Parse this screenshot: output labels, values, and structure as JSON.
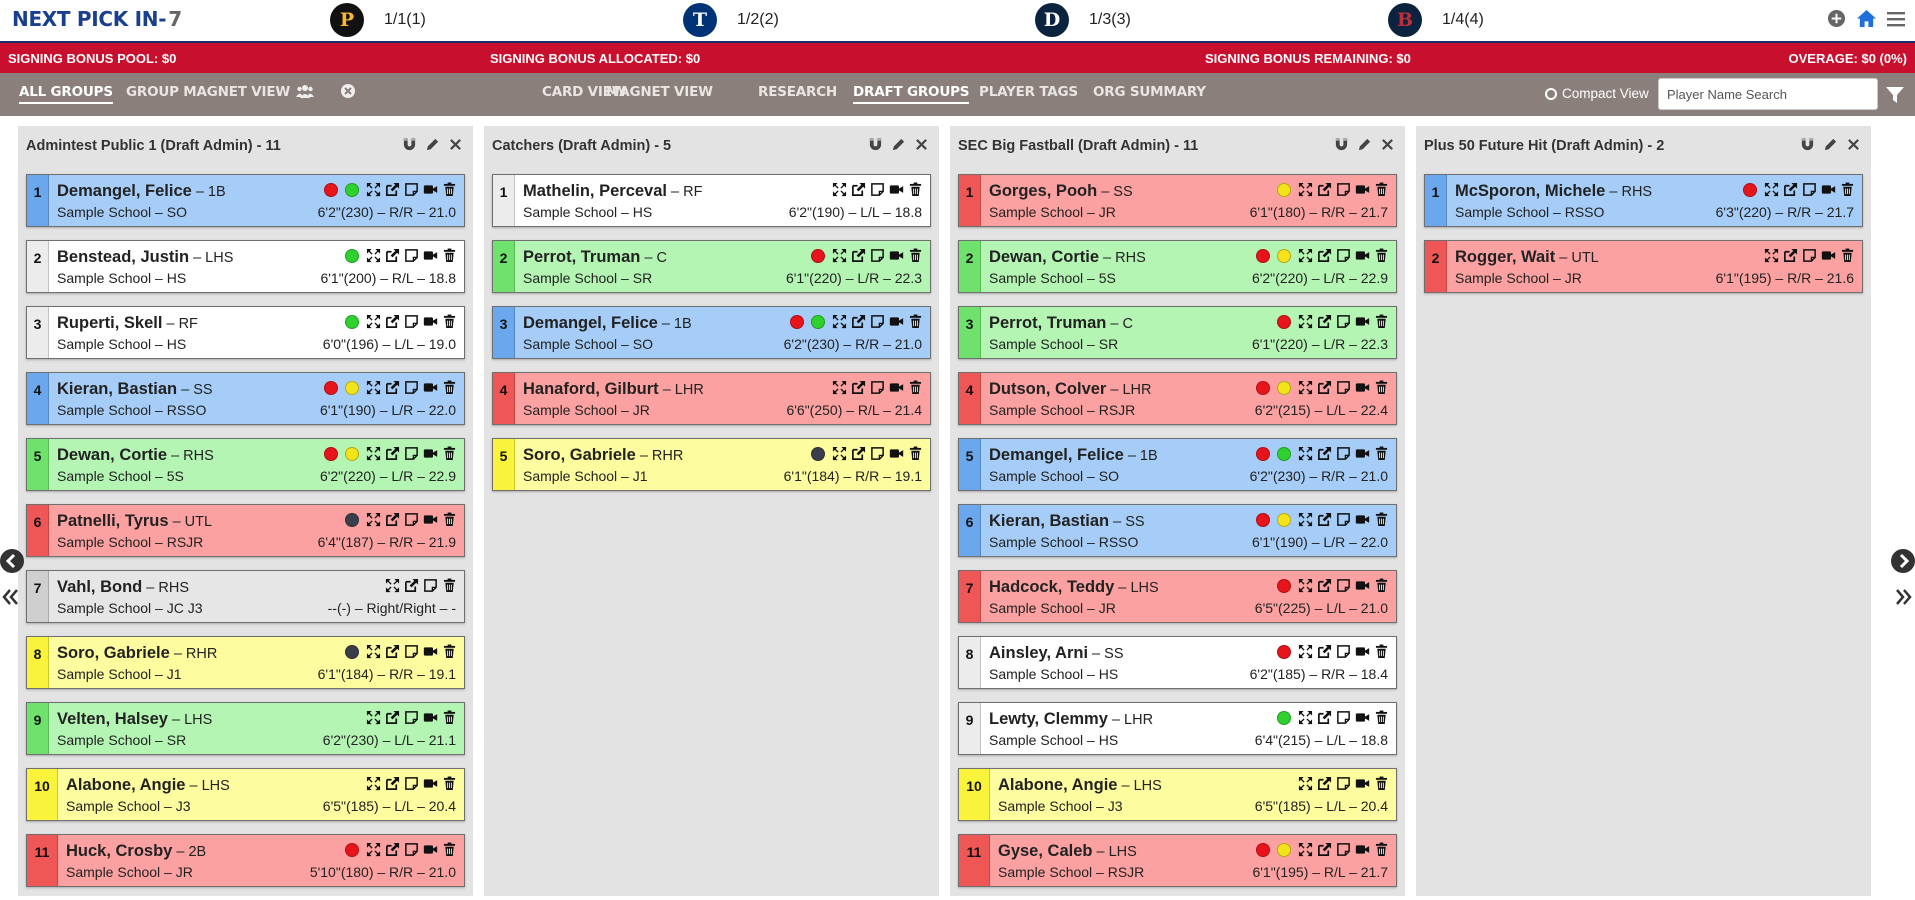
{
  "header": {
    "title": "NEXT PICK IN-",
    "count": "7",
    "picks": [
      {
        "label": "1/1(1)",
        "logo_letter": "P",
        "logo_bg": "#111111",
        "logo_fg": "#fdb827",
        "team": "pirates-logo-icon"
      },
      {
        "label": "1/2(2)",
        "logo_letter": "T",
        "logo_bg": "#003278",
        "logo_fg": "#ffffff",
        "team": "rangers-logo-icon"
      },
      {
        "label": "1/3(3)",
        "logo_letter": "D",
        "logo_bg": "#0c2340",
        "logo_fg": "#ffffff",
        "team": "tigers-logo-icon"
      },
      {
        "label": "1/4(4)",
        "logo_letter": "B",
        "logo_bg": "#0c2340",
        "logo_fg": "#bd3039",
        "team": "red-sox-logo-icon"
      }
    ]
  },
  "bonus": {
    "pool": "SIGNING BONUS POOL: $0",
    "allocated": "SIGNING BONUS ALLOCATED: $0",
    "remaining": "SIGNING BONUS REMAINING: $0",
    "overage": "OVERAGE: $0 (0%)"
  },
  "nav": {
    "all_groups": "ALL GROUPS",
    "group_magnet_view": "GROUP MAGNET VIEW",
    "card_view": "CARD VIEW",
    "magnet_view": "MAGNET VIEW",
    "research": "RESEARCH",
    "draft_groups": "DRAFT GROUPS",
    "player_tags": "PLAYER TAGS",
    "org_summary": "ORG SUMMARY",
    "compact_view": "Compact View",
    "search_placeholder": "Player Name Search"
  },
  "colors": {
    "brand_blue": "#1a3f8f",
    "bonus_red": "#c8102e",
    "nav_gray": "#8a7f7b",
    "dot_red": "#e8141c",
    "dot_green": "#2ed12e",
    "dot_yellow": "#f2e31b",
    "dot_dark": "#3a3e4a"
  },
  "groups": [
    {
      "title": "Admintest Public 1 (Draft Admin) - 11",
      "players": [
        {
          "num": "1",
          "name": "Demangel, Felice",
          "pos": " – 1B",
          "school": "Sample School – SO",
          "stats": "6'2\"(230) – R/R – 21.0",
          "color": "blue",
          "dots": [
            "red",
            "green"
          ],
          "video": true
        },
        {
          "num": "2",
          "name": "Benstead, Justin",
          "pos": " – LHS",
          "school": "Sample School – HS",
          "stats": "6'1\"(200) – R/L – 18.8",
          "color": "white",
          "dots": [
            "green"
          ],
          "video": true
        },
        {
          "num": "3",
          "name": "Ruperti, Skell",
          "pos": " – RF",
          "school": "Sample School – HS",
          "stats": "6'0\"(196) – L/L – 19.0",
          "color": "white",
          "dots": [
            "green"
          ],
          "video": true
        },
        {
          "num": "4",
          "name": "Kieran, Bastian",
          "pos": " – SS",
          "school": "Sample School – RSSO",
          "stats": "6'1\"(190) – L/R – 22.0",
          "color": "blue",
          "dots": [
            "red",
            "yellow"
          ],
          "video": true
        },
        {
          "num": "5",
          "name": "Dewan, Cortie",
          "pos": " – RHS",
          "school": "Sample School – 5S",
          "stats": "6'2\"(220) – L/R – 22.9",
          "color": "green",
          "dots": [
            "red",
            "yellow"
          ],
          "video": true
        },
        {
          "num": "6",
          "name": "Patnelli, Tyrus",
          "pos": " – UTL",
          "school": "Sample School – RSJR",
          "stats": "6'4\"(187) – R/R – 21.9",
          "color": "red",
          "dots": [
            "dark"
          ],
          "video": true
        },
        {
          "num": "7",
          "name": "Vahl, Bond",
          "pos": " – RHS",
          "school": "Sample School – JC J3",
          "stats": "--(-) – Right/Right – -",
          "color": "gray",
          "dots": [],
          "video": false
        },
        {
          "num": "8",
          "name": "Soro, Gabriele",
          "pos": " – RHR",
          "school": "Sample School – J1",
          "stats": "6'1\"(184) – R/R – 19.1",
          "color": "yellow",
          "dots": [
            "dark"
          ],
          "video": true
        },
        {
          "num": "9",
          "name": "Velten, Halsey",
          "pos": " – LHS",
          "school": "Sample School – SR",
          "stats": "6'2\"(230) – L/L – 21.1",
          "color": "green",
          "dots": [],
          "video": true
        },
        {
          "num": "10",
          "name": "Alabone, Angie",
          "pos": " – LHS",
          "school": "Sample School – J3",
          "stats": "6'5\"(185) – L/L – 20.4",
          "color": "yellow",
          "dots": [],
          "video": true
        },
        {
          "num": "11",
          "name": "Huck, Crosby",
          "pos": " – 2B",
          "school": "Sample School – JR",
          "stats": "5'10\"(180) – R/R – 21.0",
          "color": "red",
          "dots": [
            "red"
          ],
          "video": true
        }
      ]
    },
    {
      "title": "Catchers (Draft Admin) - 5",
      "players": [
        {
          "num": "1",
          "name": "Mathelin, Perceval",
          "pos": " – RF",
          "school": "Sample School – HS",
          "stats": "6'2\"(190) – L/L – 18.8",
          "color": "white",
          "dots": [],
          "video": true
        },
        {
          "num": "2",
          "name": "Perrot, Truman",
          "pos": " – C",
          "school": "Sample School – SR",
          "stats": "6'1\"(220) – L/R – 22.3",
          "color": "green",
          "dots": [
            "red"
          ],
          "video": true
        },
        {
          "num": "3",
          "name": "Demangel, Felice",
          "pos": " – 1B",
          "school": "Sample School – SO",
          "stats": "6'2\"(230) – R/R – 21.0",
          "color": "blue",
          "dots": [
            "red",
            "green"
          ],
          "video": true
        },
        {
          "num": "4",
          "name": "Hanaford, Gilburt",
          "pos": " – LHR",
          "school": "Sample School – JR",
          "stats": "6'6\"(250) – R/L – 21.4",
          "color": "red",
          "dots": [],
          "video": true
        },
        {
          "num": "5",
          "name": "Soro, Gabriele",
          "pos": " – RHR",
          "school": "Sample School – J1",
          "stats": "6'1\"(184) – R/R – 19.1",
          "color": "yellow",
          "dots": [
            "dark"
          ],
          "video": true
        }
      ]
    },
    {
      "title": "SEC Big Fastball (Draft Admin) - 11",
      "players": [
        {
          "num": "1",
          "name": "Gorges, Pooh",
          "pos": " – SS",
          "school": "Sample School – JR",
          "stats": "6'1\"(180) – R/R – 21.7",
          "color": "red",
          "dots": [
            "yellow"
          ],
          "video": true
        },
        {
          "num": "2",
          "name": "Dewan, Cortie",
          "pos": " – RHS",
          "school": "Sample School – 5S",
          "stats": "6'2\"(220) – L/R – 22.9",
          "color": "green",
          "dots": [
            "red",
            "yellow"
          ],
          "video": true
        },
        {
          "num": "3",
          "name": "Perrot, Truman",
          "pos": " – C",
          "school": "Sample School – SR",
          "stats": "6'1\"(220) – L/R – 22.3",
          "color": "green",
          "dots": [
            "red"
          ],
          "video": true
        },
        {
          "num": "4",
          "name": "Dutson, Colver",
          "pos": " – LHR",
          "school": "Sample School – RSJR",
          "stats": "6'2\"(215) – L/L – 22.4",
          "color": "red",
          "dots": [
            "red",
            "yellow"
          ],
          "video": true
        },
        {
          "num": "5",
          "name": "Demangel, Felice",
          "pos": " – 1B",
          "school": "Sample School – SO",
          "stats": "6'2\"(230) – R/R – 21.0",
          "color": "blue",
          "dots": [
            "red",
            "green"
          ],
          "video": true
        },
        {
          "num": "6",
          "name": "Kieran, Bastian",
          "pos": " – SS",
          "school": "Sample School – RSSO",
          "stats": "6'1\"(190) – L/R – 22.0",
          "color": "blue",
          "dots": [
            "red",
            "yellow"
          ],
          "video": true
        },
        {
          "num": "7",
          "name": "Hadcock, Teddy",
          "pos": " – LHS",
          "school": "Sample School – JR",
          "stats": "6'5\"(225) – L/L – 21.0",
          "color": "red",
          "dots": [
            "red"
          ],
          "video": true
        },
        {
          "num": "8",
          "name": "Ainsley, Arni",
          "pos": " – SS",
          "school": "Sample School – HS",
          "stats": "6'2\"(185) – R/R – 18.4",
          "color": "white",
          "dots": [
            "red"
          ],
          "video": true
        },
        {
          "num": "9",
          "name": "Lewty, Clemmy",
          "pos": " – LHR",
          "school": "Sample School – HS",
          "stats": "6'4\"(215) – L/L – 18.8",
          "color": "white",
          "dots": [
            "green"
          ],
          "video": true
        },
        {
          "num": "10",
          "name": "Alabone, Angie",
          "pos": " – LHS",
          "school": "Sample School – J3",
          "stats": "6'5\"(185) – L/L – 20.4",
          "color": "yellow",
          "dots": [],
          "video": true
        },
        {
          "num": "11",
          "name": "Gyse, Caleb",
          "pos": " – LHS",
          "school": "Sample School – RSJR",
          "stats": "6'1\"(195) – R/L – 21.7",
          "color": "red",
          "dots": [
            "red",
            "yellow"
          ],
          "video": true
        }
      ]
    },
    {
      "title": "Plus 50 Future Hit (Draft Admin) - 2",
      "players": [
        {
          "num": "1",
          "name": "McSporon, Michele",
          "pos": " – RHS",
          "school": "Sample School – RSSO",
          "stats": "6'3\"(220) – R/R – 21.7",
          "color": "blue",
          "dots": [
            "red"
          ],
          "video": true
        },
        {
          "num": "2",
          "name": "Rogger, Wait",
          "pos": " – UTL",
          "school": "Sample School – JR",
          "stats": "6'1\"(195) – R/R – 21.6",
          "color": "red",
          "dots": [],
          "video": true
        }
      ]
    }
  ]
}
